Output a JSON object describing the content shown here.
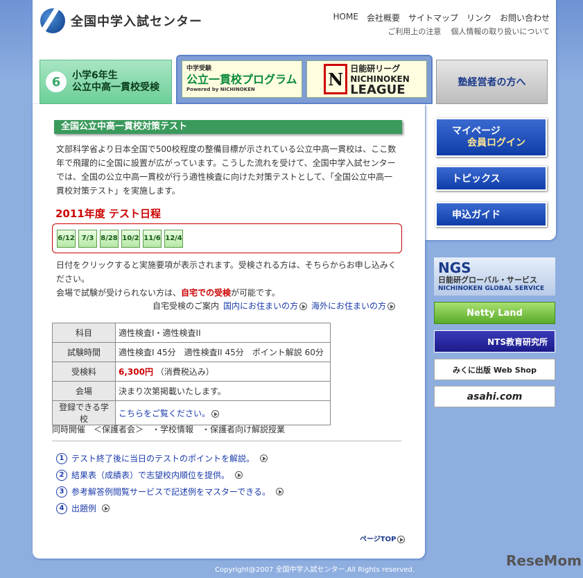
{
  "header": {
    "site_name": "全国中学入試センター",
    "nav": [
      "HOME",
      "会社概要",
      "サイトマップ",
      "リンク",
      "お問い合わせ"
    ],
    "subnav": [
      "ご利用上の注意",
      "個人情報の取り扱いについて"
    ]
  },
  "banners": {
    "b1_num": "6",
    "b1_line1": "小学6年生",
    "b1_line2": "公立中高一貫校受検",
    "b2_small": "中学受験",
    "b2_large": "公立一貫校プログラム",
    "b2_powered": "Powered by NICHINOKEN",
    "b3_letter": "N",
    "b3_line1": "日能研リーグ",
    "b3_line2": "NICHINOKEN",
    "b3_line3": "LEAGUE",
    "b4": "塾経営者の方へ"
  },
  "main": {
    "section_title": "全国公立中高一貫校対策テスト",
    "intro": "文部科学省より日本全国で500校程度の整備目標が示されている公立中高一貫校は、ここ数年で飛躍的に全国に設置が広がっています。こうした流れを受けて、全国中学入試センターでは、全国の公立中高一貫校が行う適性検査に向けた対策テストとして、「全国公立中高一貫校対策テスト」を実施します。",
    "year_title": "2011年度 テスト日程",
    "dates": [
      "6/12",
      "7/3",
      "8/28",
      "10/2",
      "11/6",
      "12/4"
    ],
    "note1": "日付をクリックすると実施要項が表示されます。受検される方は、そちらからお申し込みください。",
    "note2_pre": "会場で試験が受けられない方は、",
    "note2_red": "自宅での受検",
    "note2_post": "が可能です。",
    "home_label": "自宅受検のご案内",
    "home_link1": "国内にお住まいの方",
    "home_link2": "海外にお住まいの方",
    "table": {
      "subject_h": "科目",
      "subject_v": "適性検査I・適性検査II",
      "time_h": "試験時間",
      "time_v": "適性検査I 45分　適性検査II 45分　ポイント解説 60分",
      "fee_h": "受検料",
      "fee_price": "6,300円",
      "fee_note": "（消費税込み）",
      "venue_h": "会場",
      "venue_v": "決まり次第掲載いたします。",
      "school_h": "登録できる学校",
      "school_v": "こちらをご覧ください。"
    },
    "concurrent": "同時開催　＜保護者会＞　・学校情報　・保護者向け解説授業",
    "points": [
      {
        "n": "1",
        "t": "テスト終了後に当日のテストのポイントを解説。"
      },
      {
        "n": "2",
        "t": "結果表（成績表）で志望校内順位を提供。"
      },
      {
        "n": "3",
        "t": "参考解答例閲覧サービスで記述例をマスターできる。"
      },
      {
        "n": "4",
        "t": "出題例"
      }
    ],
    "page_top": "ページTOP"
  },
  "side": {
    "mypage1": "マイページ",
    "mypage2": "会員ログイン",
    "topics": "トピックス",
    "guide": "申込ガイド",
    "ngs_big": "NGS",
    "ngs_s1": "日能研グローバル・サービス",
    "ngs_s2": "NICHINOKEN GLOBAL SERVICE",
    "netty": "Netty Land",
    "nts": "NTS教育研究所",
    "mikuni": "みくに出版 Web Shop",
    "asahi": "asahi.com"
  },
  "footer": {
    "copyright": "Copyright@2007 全国中学入試センター.All Rights reserved.",
    "watermark": "ReseMom"
  }
}
